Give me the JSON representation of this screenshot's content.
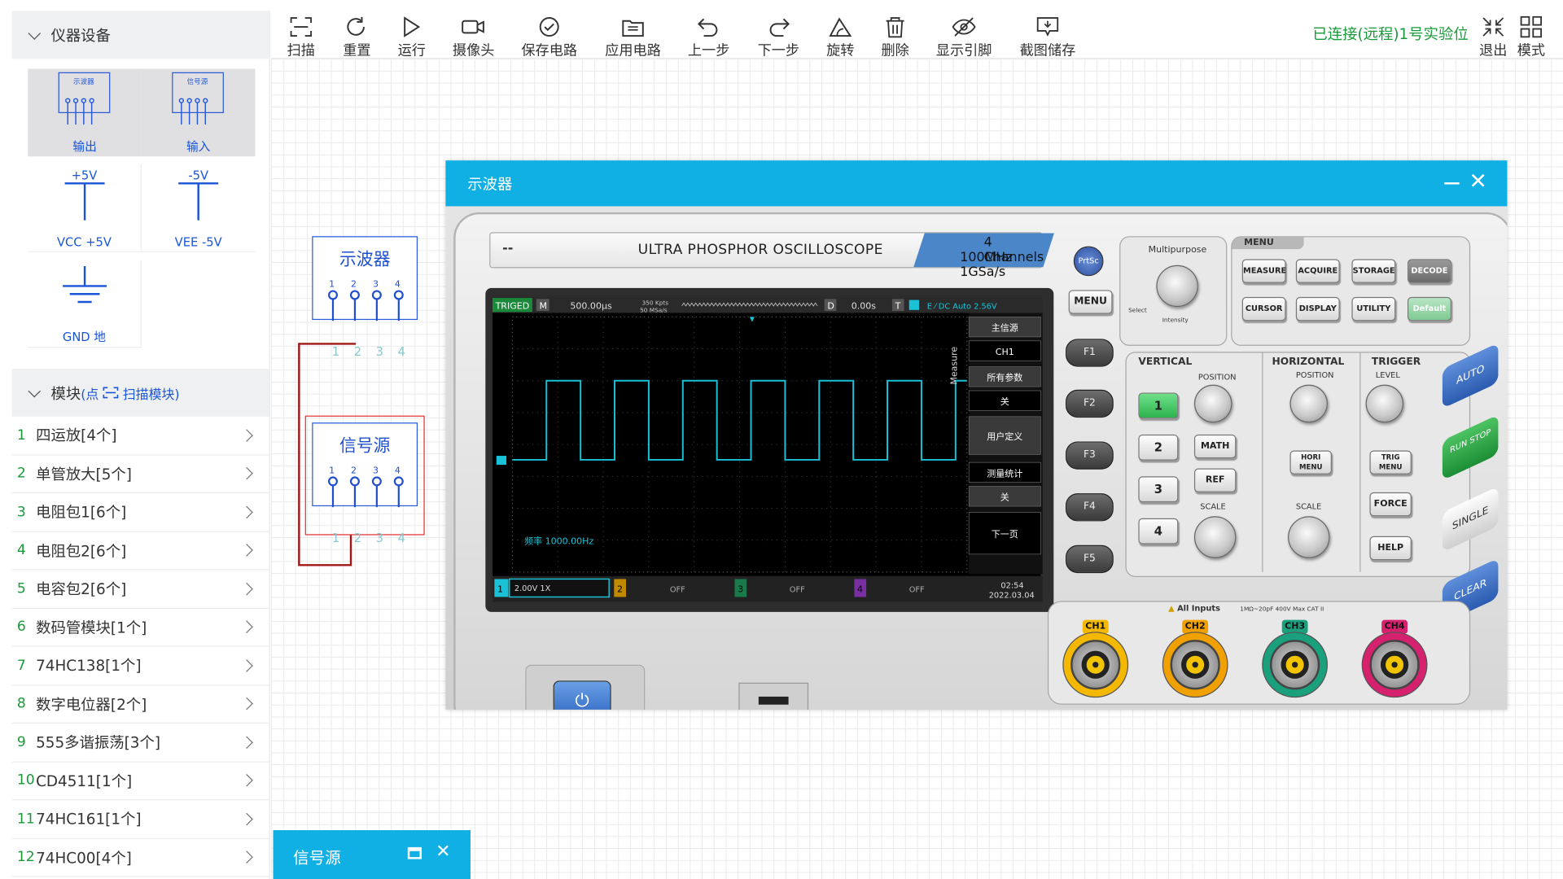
{
  "sidebar": {
    "devices_title": "仪器设备",
    "palette": {
      "osc_mini": "示波器",
      "sig_mini": "信号源",
      "output": "输出",
      "input": "输入",
      "vcc_top": "+5V",
      "vcc": "VCC +5V",
      "vee_top": "-5V",
      "vee": "VEE -5V",
      "gnd": "GND 地"
    },
    "module_title": "模块",
    "module_hint_open": "(点",
    "module_hint_scan": "扫描模块)",
    "modules": [
      {
        "n": "1",
        "label": "四运放[4个]"
      },
      {
        "n": "2",
        "label": "单管放大[5个]"
      },
      {
        "n": "3",
        "label": "电阻包1[6个]"
      },
      {
        "n": "4",
        "label": "电阻包2[6个]"
      },
      {
        "n": "5",
        "label": "电容包2[6个]"
      },
      {
        "n": "6",
        "label": "数码管模块[1个]"
      },
      {
        "n": "7",
        "label": "74HC138[1个]"
      },
      {
        "n": "8",
        "label": "数字电位器[2个]"
      },
      {
        "n": "9",
        "label": "555多谐振荡[3个]"
      },
      {
        "n": "10",
        "label": "CD4511[1个]"
      },
      {
        "n": "11",
        "label": "74HC161[1个]"
      },
      {
        "n": "12",
        "label": "74HC00[4个]"
      }
    ]
  },
  "toolbar": {
    "scan": "扫描",
    "reset": "重置",
    "run": "运行",
    "camera": "摄像头",
    "save": "保存电路",
    "apply": "应用电路",
    "undo": "上一步",
    "redo": "下一步",
    "rotate": "旋转",
    "delete": "删除",
    "pins": "显示引脚",
    "screenshot": "截图储存",
    "status": "已连接(远程)1号实验位",
    "exit": "退出",
    "mode": "模式"
  },
  "canvas": {
    "osc_block": "示波器",
    "sig_block": "信号源",
    "pins": [
      "1",
      "2",
      "3",
      "4"
    ]
  },
  "oscilloscope": {
    "window_title": "示波器",
    "model": "ULTRA PHOSPHOR OSCILLOSCOPE",
    "dash": "--",
    "channels_line1": "4 Channels",
    "channels_line2": "100MHz  1GSa/s",
    "prtsc": "PrtSc",
    "menu_btn": "MENU",
    "fbtns": [
      "F1",
      "F2",
      "F3",
      "F4",
      "F5"
    ],
    "screen": {
      "triged": "TRIGED",
      "m": "M",
      "timebase": "500.00μs",
      "kpts": "350 Kpts",
      "msas": "50 MSa/s",
      "d": "D",
      "delay": "0.00s",
      "t": "T",
      "trig": "E ⁄ DC Auto 2.56V",
      "measure": "Measure",
      "freq": "频率 1000.00Hz",
      "ch1": "2.00V 1X",
      "off2": "OFF",
      "off3": "OFF",
      "off4": "OFF",
      "time": "02:54",
      "date": "2022.03.04",
      "n1": "1",
      "n2": "2",
      "n3": "3",
      "n4": "4",
      "menu": [
        "主信源",
        "CH1",
        "所有参数",
        "关",
        "用户定义",
        "测量统计",
        "关",
        "下一页"
      ]
    },
    "multipurpose": "Multipurpose",
    "select": "Select",
    "intensity": "Intensity",
    "menu_title": "MENU",
    "menu_keys": [
      "MEASURE",
      "ACQUIRE",
      "STORAGE",
      "DECODE",
      "CURSOR",
      "DISPLAY",
      "UTILITY",
      "Default"
    ],
    "vertical": "VERTICAL",
    "horizontal": "HORIZONTAL",
    "trigger": "TRIGGER",
    "position": "POSITION",
    "scale": "SCALE",
    "level": "LEVEL",
    "ch_keys": [
      "1",
      "2",
      "3",
      "4"
    ],
    "math": "MATH",
    "ref": "REF",
    "hori_menu": "HORI MENU",
    "trig_menu": "TRIG MENU",
    "force": "FORCE",
    "help": "HELP",
    "side_keys": [
      "AUTO",
      "RUN STOP",
      "SINGLE",
      "CLEAR"
    ],
    "all_inputs": "All Inputs",
    "input_spec": "1MΩ~20pF 400V Max CAT II",
    "inputs": [
      "CH1",
      "CH2",
      "CH3",
      "CH4"
    ]
  },
  "bottom_tab": {
    "title": "信号源"
  },
  "colors": {
    "accent": "#11b0e4",
    "green": "#1a9a3a",
    "block_blue": "#2a5ad8",
    "wire": "#a01818",
    "trace": "#19c2d6",
    "ch1": "#f5b800",
    "ch2": "#f0a000",
    "ch3": "#1aa07c",
    "ch4": "#d6216e"
  }
}
